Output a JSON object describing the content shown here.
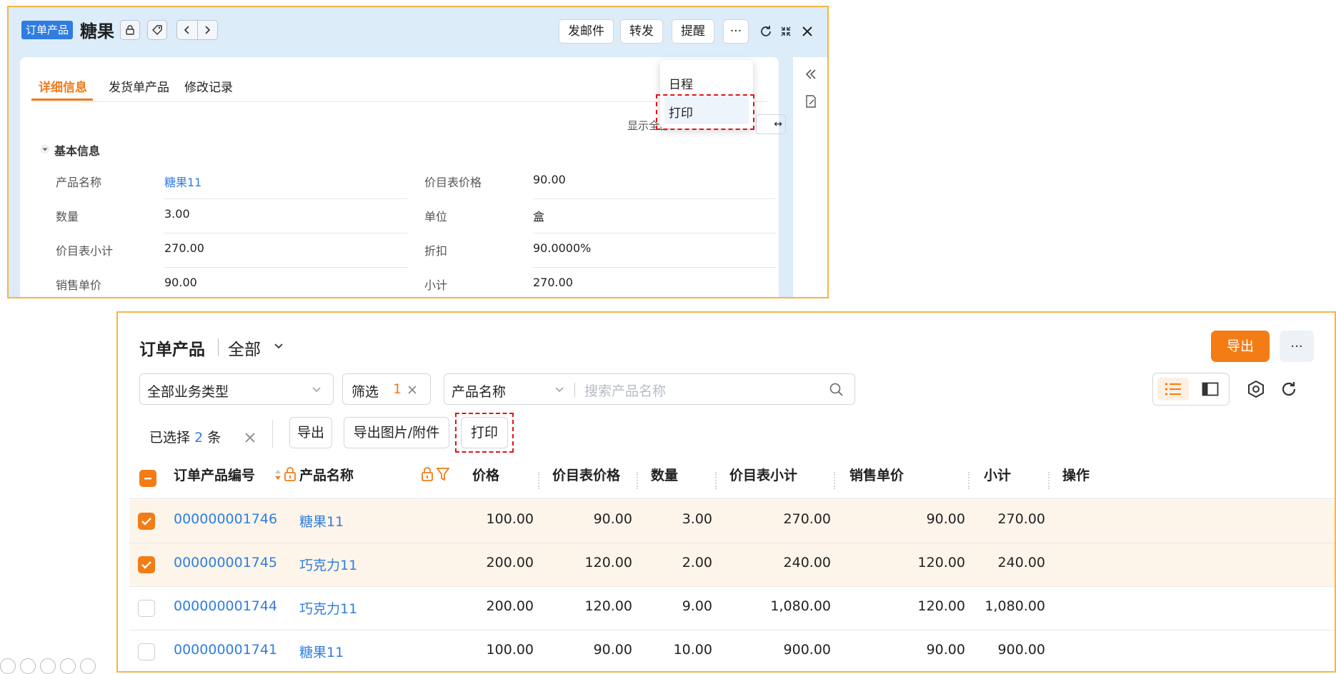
{
  "detail": {
    "tag": "订单产品",
    "title": "糖果",
    "buttons": {
      "send_email": "发邮件",
      "forward": "转发",
      "remind": "提醒",
      "more": "···"
    },
    "tabs": [
      "详细信息",
      "发货单产品",
      "修改记录"
    ],
    "show_all": "显示全部",
    "section_title": "基本信息",
    "fields": [
      {
        "label": "产品名称",
        "value": "糖果11",
        "link": true
      },
      {
        "label": "价目表价格",
        "value": "90.00"
      },
      {
        "label": "数量",
        "value": "3.00"
      },
      {
        "label": "单位",
        "value": "盒"
      },
      {
        "label": "价目表小计",
        "value": "270.00"
      },
      {
        "label": "折扣",
        "value": "90.0000%"
      },
      {
        "label": "销售单价",
        "value": "90.00"
      },
      {
        "label": "小计",
        "value": "270.00"
      }
    ],
    "dropdown": [
      "日程",
      "打印"
    ]
  },
  "list": {
    "title": "订单产品",
    "scope": "全部",
    "export_button": "导出",
    "more_button": "···",
    "business_type": "全部业务类型",
    "filter_label": "筛选",
    "filter_count": "1",
    "search_field": "产品名称",
    "search_placeholder": "搜索产品名称",
    "selected_prefix": "已选择",
    "selected_count": "2",
    "selected_suffix": "条",
    "actions": [
      "导出",
      "导出图片/附件",
      "打印"
    ],
    "columns": [
      "订单产品编号",
      "产品名称",
      "价格",
      "价目表价格",
      "数量",
      "价目表小计",
      "销售单价",
      "小计",
      "操作"
    ],
    "rows": [
      {
        "checked": true,
        "id": "000000001746",
        "name": "糖果11",
        "price": "100.00",
        "list_price": "90.00",
        "qty": "3.00",
        "list_subtotal": "270.00",
        "unit_price": "90.00",
        "subtotal": "270.00"
      },
      {
        "checked": true,
        "id": "000000001745",
        "name": "巧克力11",
        "price": "200.00",
        "list_price": "120.00",
        "qty": "2.00",
        "list_subtotal": "240.00",
        "unit_price": "120.00",
        "subtotal": "240.00"
      },
      {
        "checked": false,
        "id": "000000001744",
        "name": "巧克力11",
        "price": "200.00",
        "list_price": "120.00",
        "qty": "9.00",
        "list_subtotal": "1,080.00",
        "unit_price": "120.00",
        "subtotal": "1,080.00"
      },
      {
        "checked": false,
        "id": "000000001741",
        "name": "糖果11",
        "price": "100.00",
        "list_price": "90.00",
        "qty": "10.00",
        "list_subtotal": "900.00",
        "unit_price": "90.00",
        "subtotal": "900.00"
      }
    ]
  },
  "colors": {
    "accent": "#f47c15",
    "link": "#2f7de1",
    "highlight_border": "#f5b544",
    "dash_red": "#e0141a"
  }
}
